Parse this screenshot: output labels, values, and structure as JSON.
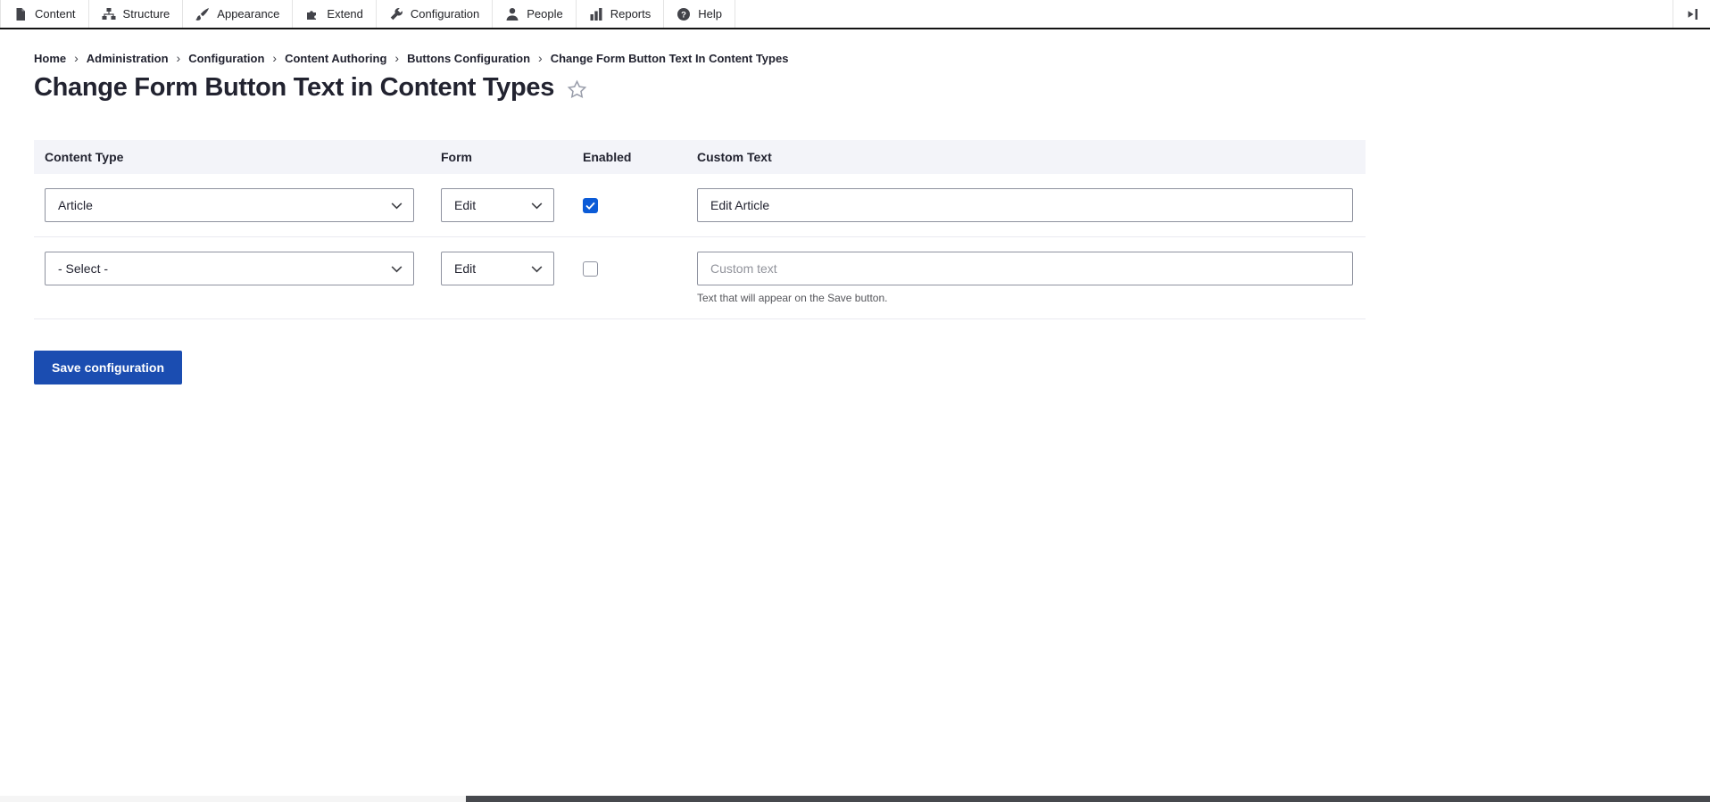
{
  "toolbar": {
    "items": [
      {
        "label": "Content",
        "icon": "document-icon"
      },
      {
        "label": "Structure",
        "icon": "sitemap-icon"
      },
      {
        "label": "Appearance",
        "icon": "paintbrush-icon"
      },
      {
        "label": "Extend",
        "icon": "puzzle-icon"
      },
      {
        "label": "Configuration",
        "icon": "wrench-icon"
      },
      {
        "label": "People",
        "icon": "person-icon"
      },
      {
        "label": "Reports",
        "icon": "bar-chart-icon"
      },
      {
        "label": "Help",
        "icon": "help-icon"
      }
    ]
  },
  "breadcrumb": {
    "separator": "›",
    "items": [
      "Home",
      "Administration",
      "Configuration",
      "Content Authoring",
      "Buttons Configuration",
      "Change Form Button Text In Content Types"
    ]
  },
  "page": {
    "title": "Change Form Button Text in Content Types"
  },
  "table": {
    "headers": [
      "Content Type",
      "Form",
      "Enabled",
      "Custom Text"
    ],
    "rows": [
      {
        "content_type": "Article",
        "form": "Edit",
        "enabled": true,
        "custom_text": "Edit Article"
      },
      {
        "content_type": "- Select -",
        "form": "Edit",
        "enabled": false,
        "custom_text": "",
        "custom_text_placeholder": "Custom text",
        "description": "Text that will appear on the Save button."
      }
    ]
  },
  "actions": {
    "save_label": "Save configuration"
  },
  "colors": {
    "primary": "#1b4db1",
    "checkbox_checked": "#0b5bd7",
    "table_header_bg": "#f3f4f9"
  }
}
